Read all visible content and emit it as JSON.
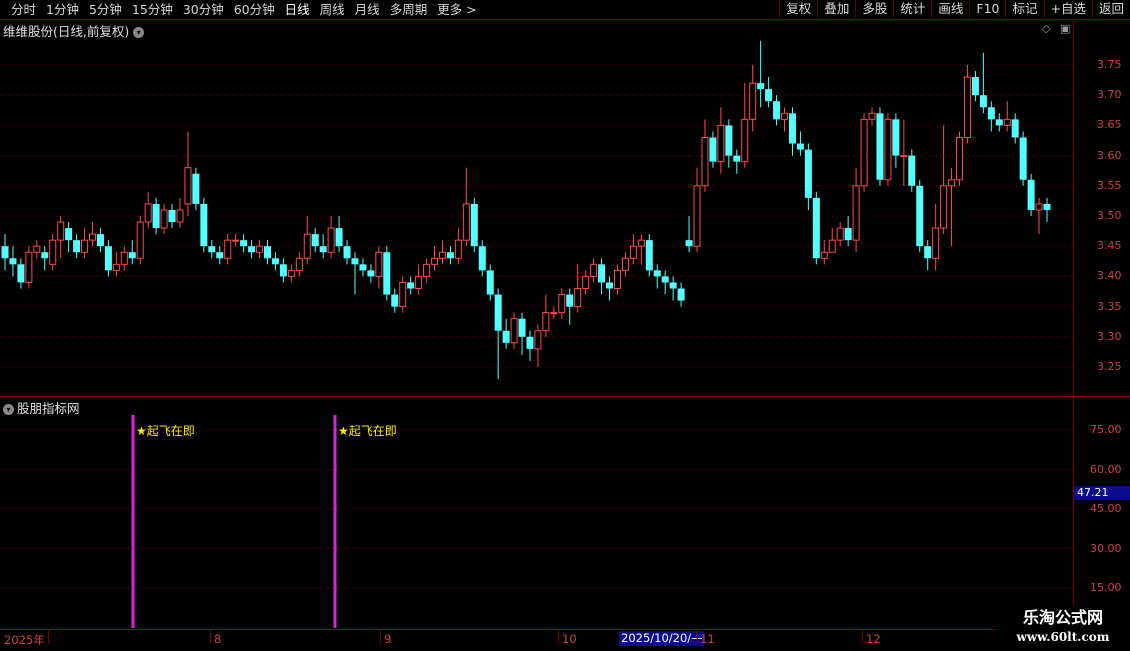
{
  "toolbar": {
    "periods": [
      "分时",
      "1分钟",
      "5分钟",
      "15分钟",
      "30分钟",
      "60分钟",
      "日线",
      "周线",
      "月线",
      "多周期",
      "更多 >"
    ],
    "active_period": "日线",
    "right_buttons": [
      "复权",
      "叠加",
      "多股",
      "统计",
      "画线",
      "F10",
      "标记",
      "+自选",
      "返回"
    ]
  },
  "main": {
    "title": "维维股份(日线,前复权)",
    "price_labels": [
      "3.75",
      "3.70",
      "3.65",
      "3.60",
      "3.55",
      "3.50",
      "3.45",
      "3.40",
      "3.35",
      "3.30",
      "3.25"
    ]
  },
  "indicator": {
    "title": "股朋指标网",
    "labels": [
      "75.00",
      "60.00",
      "45.00",
      "30.00",
      "15.00"
    ],
    "current_value": "47.21",
    "signal_label": "★起飞在即",
    "signals": [
      {
        "label": "★起飞在即"
      },
      {
        "label": "★起飞在即"
      }
    ]
  },
  "xaxis": {
    "labels": [
      "2025年",
      "8",
      "9",
      "10",
      "11",
      "12"
    ],
    "cursor_date": "2025/10/20/—"
  },
  "watermark": {
    "line1": "乐淘公式网",
    "line2": "www.60lt.com"
  },
  "colors": {
    "up": "#ff4a4a",
    "down": "#54ffff",
    "grid": "#7a0000",
    "signal_bar": "#e020e0",
    "signal_text": "#ffe600"
  },
  "chart_data": {
    "type": "candlestick",
    "ylim": [
      3.21,
      3.79
    ],
    "candles": [
      [
        3.45,
        3.43,
        3.47,
        3.41
      ],
      [
        3.43,
        3.42,
        3.45,
        3.4
      ],
      [
        3.42,
        3.39,
        3.43,
        3.38
      ],
      [
        3.39,
        3.44,
        3.45,
        3.38
      ],
      [
        3.44,
        3.45,
        3.46,
        3.43
      ],
      [
        3.44,
        3.43,
        3.45,
        3.41
      ],
      [
        3.42,
        3.46,
        3.47,
        3.41
      ],
      [
        3.46,
        3.49,
        3.5,
        3.43
      ],
      [
        3.48,
        3.46,
        3.49,
        3.44
      ],
      [
        3.46,
        3.44,
        3.47,
        3.43
      ],
      [
        3.44,
        3.46,
        3.48,
        3.43
      ],
      [
        3.46,
        3.47,
        3.49,
        3.45
      ],
      [
        3.47,
        3.45,
        3.48,
        3.44
      ],
      [
        3.45,
        3.41,
        3.46,
        3.4
      ],
      [
        3.41,
        3.42,
        3.44,
        3.4
      ],
      [
        3.42,
        3.44,
        3.45,
        3.41
      ],
      [
        3.44,
        3.43,
        3.46,
        3.42
      ],
      [
        3.43,
        3.49,
        3.5,
        3.42
      ],
      [
        3.49,
        3.52,
        3.54,
        3.48
      ],
      [
        3.52,
        3.48,
        3.53,
        3.47
      ],
      [
        3.48,
        3.51,
        3.52,
        3.47
      ],
      [
        3.51,
        3.49,
        3.52,
        3.48
      ],
      [
        3.49,
        3.51,
        3.53,
        3.48
      ],
      [
        3.52,
        3.58,
        3.64,
        3.5
      ],
      [
        3.57,
        3.52,
        3.58,
        3.51
      ],
      [
        3.52,
        3.45,
        3.53,
        3.44
      ],
      [
        3.45,
        3.44,
        3.46,
        3.43
      ],
      [
        3.44,
        3.43,
        3.45,
        3.42
      ],
      [
        3.43,
        3.46,
        3.47,
        3.42
      ],
      [
        3.46,
        3.46,
        3.47,
        3.45
      ],
      [
        3.46,
        3.45,
        3.47,
        3.44
      ],
      [
        3.45,
        3.44,
        3.46,
        3.43
      ],
      [
        3.44,
        3.45,
        3.46,
        3.43
      ],
      [
        3.45,
        3.43,
        3.46,
        3.42
      ],
      [
        3.43,
        3.42,
        3.44,
        3.41
      ],
      [
        3.42,
        3.4,
        3.43,
        3.39
      ],
      [
        3.4,
        3.41,
        3.42,
        3.39
      ],
      [
        3.41,
        3.43,
        3.44,
        3.4
      ],
      [
        3.43,
        3.47,
        3.5,
        3.42
      ],
      [
        3.47,
        3.45,
        3.48,
        3.44
      ],
      [
        3.45,
        3.44,
        3.47,
        3.43
      ],
      [
        3.44,
        3.48,
        3.5,
        3.43
      ],
      [
        3.48,
        3.45,
        3.5,
        3.44
      ],
      [
        3.45,
        3.43,
        3.46,
        3.42
      ],
      [
        3.43,
        3.42,
        3.44,
        3.37
      ],
      [
        3.42,
        3.41,
        3.43,
        3.4
      ],
      [
        3.41,
        3.4,
        3.42,
        3.39
      ],
      [
        3.4,
        3.44,
        3.45,
        3.38
      ],
      [
        3.44,
        3.37,
        3.45,
        3.36
      ],
      [
        3.37,
        3.35,
        3.38,
        3.34
      ],
      [
        3.35,
        3.39,
        3.4,
        3.34
      ],
      [
        3.39,
        3.38,
        3.4,
        3.37
      ],
      [
        3.38,
        3.4,
        3.42,
        3.37
      ],
      [
        3.4,
        3.42,
        3.43,
        3.39
      ],
      [
        3.42,
        3.43,
        3.45,
        3.41
      ],
      [
        3.43,
        3.44,
        3.46,
        3.42
      ],
      [
        3.44,
        3.43,
        3.45,
        3.42
      ],
      [
        3.43,
        3.46,
        3.48,
        3.42
      ],
      [
        3.46,
        3.52,
        3.58,
        3.45
      ],
      [
        3.52,
        3.45,
        3.53,
        3.44
      ],
      [
        3.45,
        3.41,
        3.46,
        3.4
      ],
      [
        3.41,
        3.37,
        3.42,
        3.36
      ],
      [
        3.37,
        3.31,
        3.38,
        3.23
      ],
      [
        3.31,
        3.29,
        3.33,
        3.28
      ],
      [
        3.29,
        3.33,
        3.34,
        3.28
      ],
      [
        3.33,
        3.3,
        3.34,
        3.27
      ],
      [
        3.3,
        3.28,
        3.31,
        3.26
      ],
      [
        3.28,
        3.31,
        3.32,
        3.25
      ],
      [
        3.31,
        3.34,
        3.37,
        3.3
      ],
      [
        3.34,
        3.34,
        3.35,
        3.33
      ],
      [
        3.34,
        3.37,
        3.38,
        3.33
      ],
      [
        3.37,
        3.35,
        3.38,
        3.32
      ],
      [
        3.35,
        3.38,
        3.42,
        3.34
      ],
      [
        3.38,
        3.4,
        3.41,
        3.37
      ],
      [
        3.4,
        3.42,
        3.43,
        3.39
      ],
      [
        3.42,
        3.39,
        3.43,
        3.37
      ],
      [
        3.39,
        3.38,
        3.4,
        3.36
      ],
      [
        3.38,
        3.41,
        3.42,
        3.37
      ],
      [
        3.41,
        3.43,
        3.44,
        3.4
      ],
      [
        3.43,
        3.45,
        3.47,
        3.42
      ],
      [
        3.45,
        3.46,
        3.47,
        3.42
      ],
      [
        3.46,
        3.41,
        3.47,
        3.4
      ],
      [
        3.41,
        3.4,
        3.42,
        3.38
      ],
      [
        3.4,
        3.39,
        3.41,
        3.37
      ],
      [
        3.39,
        3.38,
        3.4,
        3.36
      ],
      [
        3.38,
        3.36,
        3.39,
        3.35
      ],
      [
        3.46,
        3.45,
        3.5,
        3.44
      ],
      [
        3.45,
        3.55,
        3.58,
        3.44
      ],
      [
        3.55,
        3.63,
        3.66,
        3.54
      ],
      [
        3.63,
        3.59,
        3.64,
        3.58
      ],
      [
        3.59,
        3.65,
        3.68,
        3.57
      ],
      [
        3.65,
        3.6,
        3.66,
        3.58
      ],
      [
        3.6,
        3.59,
        3.61,
        3.57
      ],
      [
        3.59,
        3.66,
        3.72,
        3.58
      ],
      [
        3.66,
        3.72,
        3.75,
        3.64
      ],
      [
        3.72,
        3.71,
        3.79,
        3.68
      ],
      [
        3.71,
        3.69,
        3.73,
        3.68
      ],
      [
        3.69,
        3.66,
        3.7,
        3.65
      ],
      [
        3.66,
        3.67,
        3.68,
        3.64
      ],
      [
        3.67,
        3.62,
        3.68,
        3.6
      ],
      [
        3.62,
        3.61,
        3.64,
        3.6
      ],
      [
        3.61,
        3.53,
        3.62,
        3.51
      ],
      [
        3.53,
        3.43,
        3.54,
        3.42
      ],
      [
        3.43,
        3.44,
        3.46,
        3.42
      ],
      [
        3.44,
        3.46,
        3.48,
        3.45
      ],
      [
        3.46,
        3.48,
        3.49,
        3.45
      ],
      [
        3.48,
        3.46,
        3.5,
        3.45
      ],
      [
        3.46,
        3.55,
        3.58,
        3.44
      ],
      [
        3.55,
        3.66,
        3.67,
        3.54
      ],
      [
        3.66,
        3.67,
        3.68,
        3.65
      ],
      [
        3.67,
        3.56,
        3.68,
        3.55
      ],
      [
        3.56,
        3.66,
        3.67,
        3.55
      ],
      [
        3.66,
        3.6,
        3.67,
        3.58
      ],
      [
        3.6,
        3.6,
        3.66,
        3.55
      ],
      [
        3.6,
        3.55,
        3.61,
        3.54
      ],
      [
        3.55,
        3.45,
        3.56,
        3.44
      ],
      [
        3.45,
        3.43,
        3.46,
        3.41
      ],
      [
        3.43,
        3.48,
        3.52,
        3.41
      ],
      [
        3.48,
        3.55,
        3.65,
        3.47
      ],
      [
        3.55,
        3.56,
        3.58,
        3.45
      ],
      [
        3.56,
        3.63,
        3.64,
        3.55
      ],
      [
        3.63,
        3.73,
        3.75,
        3.62
      ],
      [
        3.73,
        3.7,
        3.74,
        3.69
      ],
      [
        3.7,
        3.68,
        3.77,
        3.67
      ],
      [
        3.68,
        3.66,
        3.69,
        3.64
      ],
      [
        3.66,
        3.65,
        3.67,
        3.64
      ],
      [
        3.65,
        3.66,
        3.69,
        3.64
      ],
      [
        3.66,
        3.63,
        3.67,
        3.62
      ],
      [
        3.63,
        3.56,
        3.64,
        3.55
      ],
      [
        3.56,
        3.51,
        3.57,
        3.5
      ],
      [
        3.51,
        3.52,
        3.53,
        3.47
      ],
      [
        3.52,
        3.51,
        3.53,
        3.49
      ]
    ]
  }
}
